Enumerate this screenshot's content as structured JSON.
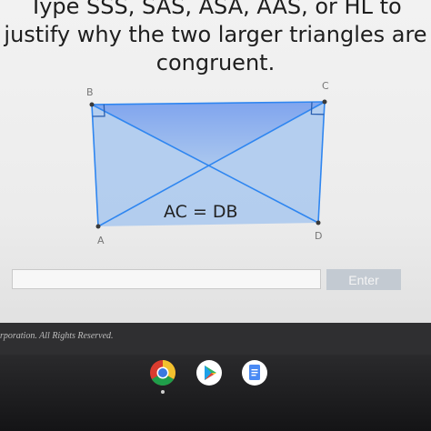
{
  "question": {
    "lines": [
      "Type SSS, SAS, ASA, AAS, or HL to",
      "justify why the two larger triangles are",
      "congruent."
    ]
  },
  "diagram": {
    "labels": {
      "a": "A",
      "b": "B",
      "c": "C",
      "d": "D"
    },
    "given": "AC = DB",
    "fill_color": "#a7c9ef",
    "top_fill_color": "#7aa3ef",
    "line_color": "#2f86f0"
  },
  "answer": {
    "value": "",
    "placeholder": ""
  },
  "enter_button": {
    "label": "Enter"
  },
  "footer": {
    "copyright": "rporation. All Rights Reserved."
  },
  "shelf": {
    "apps": [
      "chrome-icon",
      "play-store-icon",
      "docs-icon"
    ]
  }
}
